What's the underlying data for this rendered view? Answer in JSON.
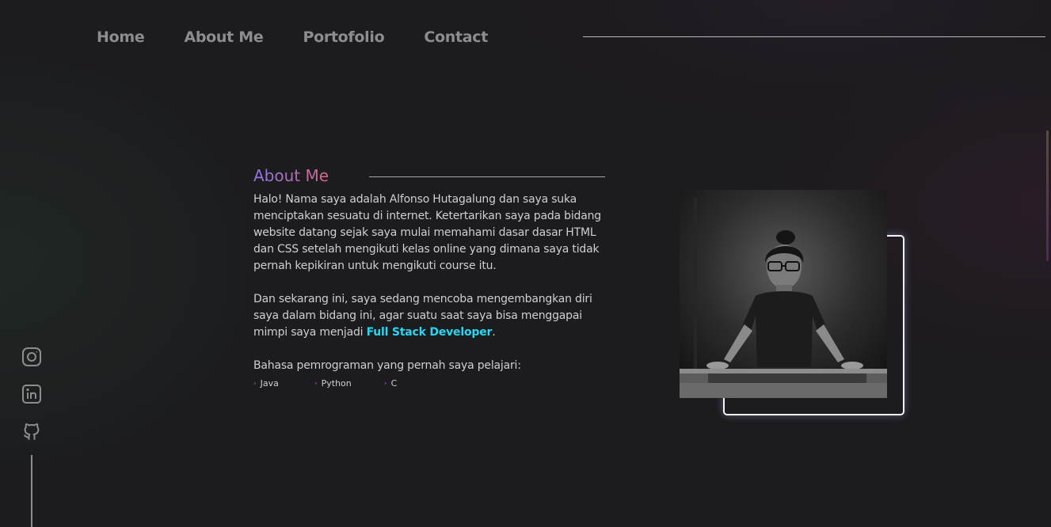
{
  "nav": {
    "items": [
      "Home",
      "About Me",
      "Portofolio",
      "Contact"
    ]
  },
  "social": {
    "icons": [
      "instagram-icon",
      "linkedin-icon",
      "github-icon"
    ]
  },
  "about": {
    "title": "About Me",
    "paragraph1": "Halo! Nama saya adalah Alfonso Hutagalung dan saya suka menciptakan sesuatu di internet. Ketertarikan saya pada bidang website datang sejak saya mulai memahami dasar dasar HTML dan CSS setelah mengikuti kelas online yang dimana saya tidak pernah kepikiran untuk mengikuti course itu.",
    "paragraph2_before": "Dan sekarang ini, saya sedang mencoba mengembangkan diri saya dalam bidang ini, agar suatu saat saya bisa menggapai mimpi saya menjadi ",
    "paragraph2_highlight": "Full Stack Developer",
    "paragraph2_after": ".",
    "languages_label": "Bahasa pemrograman yang pernah saya pelajari:",
    "languages": [
      "Java",
      "Python",
      "C"
    ]
  },
  "colors": {
    "background": "#1c1b1e",
    "nav_text": "#8d8d8f",
    "highlight": "#2ad6f0",
    "title_gradient_start": "#8b76e6",
    "title_gradient_end": "#d46a8a",
    "bullet": "#a04ec0"
  }
}
